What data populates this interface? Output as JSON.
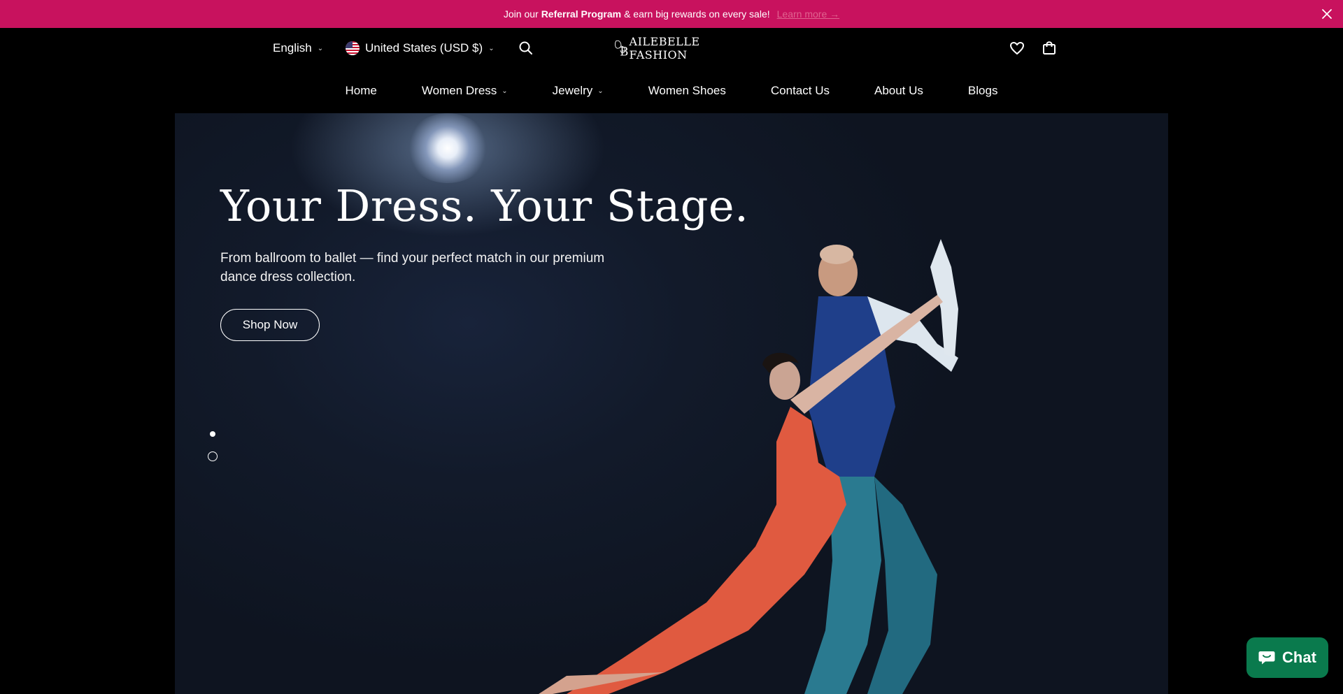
{
  "announcement": {
    "prefix": "Join our",
    "bold": "Referral Program",
    "suffix": "& earn big rewards on every sale!",
    "link": "Learn more →",
    "close_icon": "close-icon",
    "background": "#c8125e"
  },
  "header": {
    "language": "English",
    "currency": "United States (USD $)",
    "logo_text": "AILEBELLE FASHION",
    "logo_initial": "B",
    "icons": [
      "search-icon",
      "heart-icon",
      "shopping-bag-icon"
    ]
  },
  "nav": {
    "items": [
      {
        "label": "Home"
      },
      {
        "label": "Women Dress"
      },
      {
        "label": "Jewelry"
      },
      {
        "label": "Women Shoes"
      },
      {
        "label": "Contact Us"
      },
      {
        "label": "About Us"
      },
      {
        "label": "Blogs"
      }
    ]
  },
  "hero": {
    "title": "Your Dress. Your Stage.",
    "subtitle": "From ballroom to ballet — find your perfect match in our premium dance dress collection.",
    "cta": "Shop Now",
    "slides": 2,
    "active_slide": 1
  },
  "chat": {
    "label": "Chat",
    "color": "#0a7a4d"
  }
}
